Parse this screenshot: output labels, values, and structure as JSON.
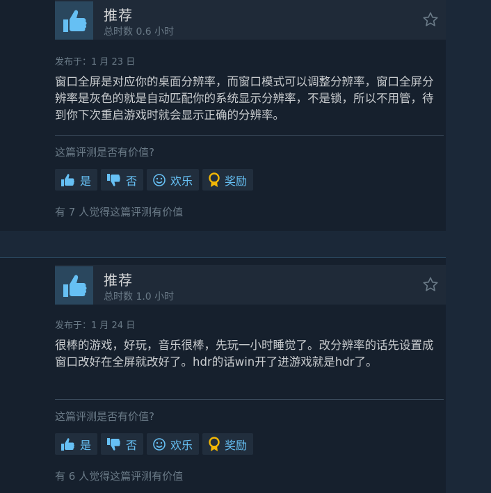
{
  "reviews": [
    {
      "recommendation": "推荐",
      "hours": "总时数 0.6 小时",
      "posted": "发布于：1 月 23 日",
      "text": "窗口全屏是对应你的桌面分辨率，而窗口模式可以调整分辨率，窗口全屏分辨率是灰色的就是自动匹配你的系统显示分辨率，不是锁，所以不用管，待到你下次重启游戏时就会显示正确的分辨率。",
      "question": "这篇评测是否有价值?",
      "buttons": {
        "yes": "是",
        "no": "否",
        "funny": "欢乐",
        "award": "奖励"
      },
      "helpful": "有 7 人觉得这篇评测有价值"
    },
    {
      "recommendation": "推荐",
      "hours": "总时数 1.0 小时",
      "posted": "发布于：1 月 24 日",
      "text": "很棒的游戏，好玩，音乐很棒，先玩一小时睡觉了。改分辨率的话先设置成窗口改好在全屏就改好了。hdr的话win开了进游戏就是hdr了。",
      "question": "这篇评测是否有价值?",
      "buttons": {
        "yes": "是",
        "no": "否",
        "funny": "欢乐",
        "award": "奖励"
      },
      "helpful": "有 6 人觉得这篇评测有价值"
    }
  ],
  "colors": {
    "background": "#1b2838",
    "panel": "#16202d",
    "link": "#66c0f4",
    "award": "#f2b705"
  },
  "icons": [
    "thumbs-up-icon",
    "star-icon",
    "thumb-up-small-icon",
    "thumb-down-small-icon",
    "smiley-icon",
    "award-icon"
  ]
}
